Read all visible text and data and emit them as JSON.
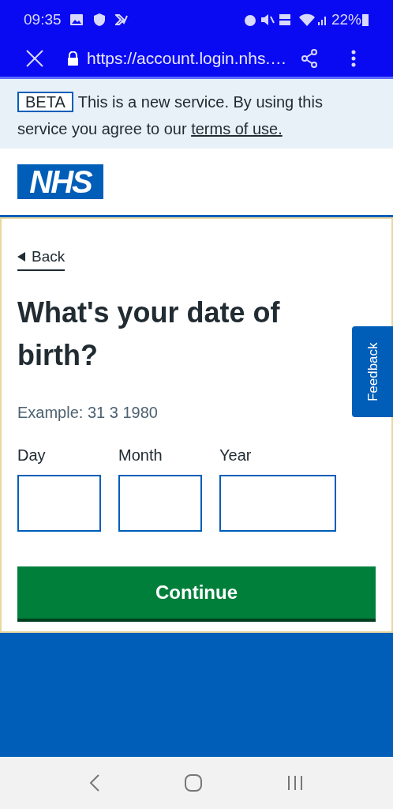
{
  "status_bar": {
    "time": "09:35",
    "battery": "22%"
  },
  "browser": {
    "url": "https://account.login.nhs.…"
  },
  "banner": {
    "tag": "BETA",
    "text": "This is a new service. By using this service you agree to our",
    "link": "terms of use."
  },
  "header": {
    "logo": "NHS"
  },
  "form": {
    "back": "Back",
    "title": "What's your date of birth?",
    "hint": "Example: 31 3 1980",
    "fields": [
      {
        "label": "Day",
        "kind": "short"
      },
      {
        "label": "Month",
        "kind": "short"
      },
      {
        "label": "Year",
        "kind": "long"
      }
    ],
    "button": "Continue"
  },
  "feedback": "Feedback"
}
